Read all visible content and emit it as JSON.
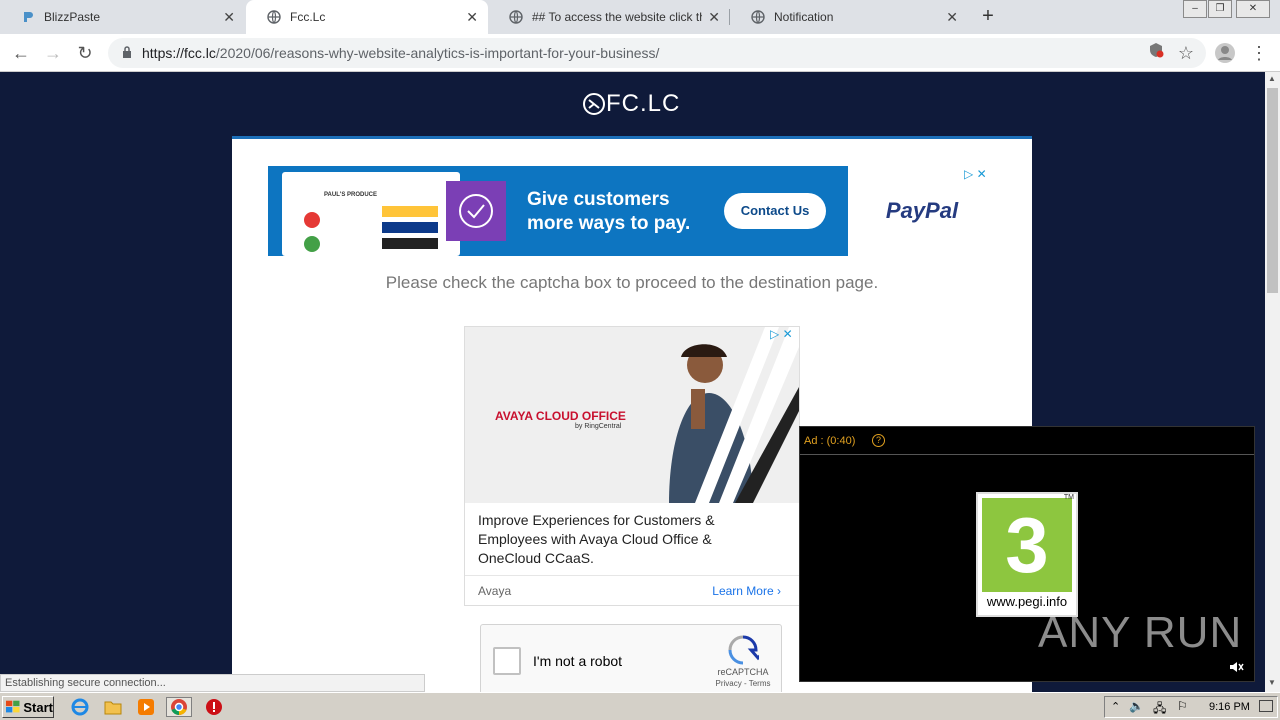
{
  "browser": {
    "tabs": [
      {
        "label": "BlizzPaste",
        "icon": "pastebin-icon",
        "active": false
      },
      {
        "label": "Fcc.Lc",
        "icon": "globe-icon",
        "active": true
      },
      {
        "label": "## To access the website click the \"A",
        "icon": "globe-icon",
        "active": false
      },
      {
        "label": "Notification",
        "icon": "globe-icon",
        "active": false
      }
    ],
    "url_host": "https://fcc.lc",
    "url_path": "/2020/06/reasons-why-website-analytics-is-important-for-your-business/"
  },
  "page": {
    "logo_text": "FC.LC",
    "notice": "Please check the captcha box to proceed to the destination page.",
    "banner_ad": {
      "store_name": "PAUL'S PRODUCE",
      "headline_line1": "Give customers",
      "headline_line2": "more ways to pay.",
      "cta": "Contact Us",
      "brand": "PayPal"
    },
    "mid_ad": {
      "brand": "AVAYA CLOUD OFFICE",
      "brand_sub": "by RingCentral",
      "title": "Improve Experiences for Customers & Employees with Avaya Cloud Office & OneCloud CCaaS.",
      "advertiser": "Avaya",
      "cta": "Learn More"
    },
    "captcha": {
      "label": "I'm not a robot",
      "brand": "reCAPTCHA",
      "links": "Privacy - Terms"
    },
    "video_ad": {
      "timer": "Ad : (0:40)",
      "help": "?",
      "rating": "3",
      "rating_tm": "TM",
      "rating_site": "www.pegi.info"
    },
    "watermark": "ANY RUN"
  },
  "status": "Establishing secure connection...",
  "taskbar": {
    "start": "Start",
    "time": "9:16 PM"
  },
  "colors": {
    "page_bg": "#0f1a3a",
    "accent": "#1c6fb8",
    "paypal_blue": "#0d75c1"
  }
}
